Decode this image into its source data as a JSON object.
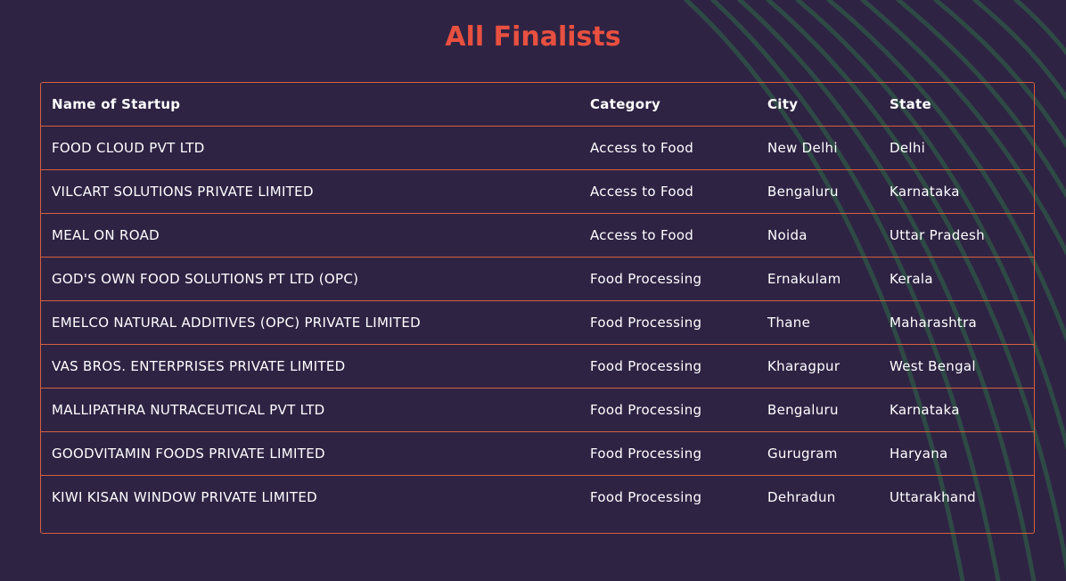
{
  "page": {
    "title": "All Finalists"
  },
  "colors": {
    "background": "#2f2344",
    "accent": "#e8503f",
    "border": "#d2603f",
    "arcs": "#2e4a45"
  },
  "table": {
    "headers": {
      "name": "Name of Startup",
      "category": "Category",
      "city": "City",
      "state": "State"
    },
    "rows": [
      {
        "name": "FOOD CLOUD PVT LTD",
        "category": "Access to Food",
        "city": "New Delhi",
        "state": "Delhi"
      },
      {
        "name": "VILCART SOLUTIONS PRIVATE LIMITED",
        "category": "Access to Food",
        "city": "Bengaluru",
        "state": "Karnataka"
      },
      {
        "name": "MEAL ON ROAD",
        "category": "Access to Food",
        "city": "Noida",
        "state": "Uttar Pradesh"
      },
      {
        "name": "GOD'S OWN FOOD SOLUTIONS PT LTD (OPC)",
        "category": "Food Processing",
        "city": "Ernakulam",
        "state": "Kerala"
      },
      {
        "name": "EMELCO NATURAL ADDITIVES (OPC) PRIVATE LIMITED",
        "category": "Food Processing",
        "city": "Thane",
        "state": "Maharashtra"
      },
      {
        "name": "VAS BROS. ENTERPRISES PRIVATE LIMITED",
        "category": "Food Processing",
        "city": "Kharagpur",
        "state": "West Bengal"
      },
      {
        "name": "MALLIPATHRA NUTRACEUTICAL PVT LTD",
        "category": "Food Processing",
        "city": "Bengaluru",
        "state": "Karnataka"
      },
      {
        "name": "GOODVITAMIN FOODS PRIVATE LIMITED",
        "category": "Food Processing",
        "city": "Gurugram",
        "state": "Haryana"
      },
      {
        "name": "KIWI KISAN WINDOW PRIVATE LIMITED",
        "category": "Food Processing",
        "city": "Dehradun",
        "state": "Uttarakhand"
      }
    ]
  }
}
